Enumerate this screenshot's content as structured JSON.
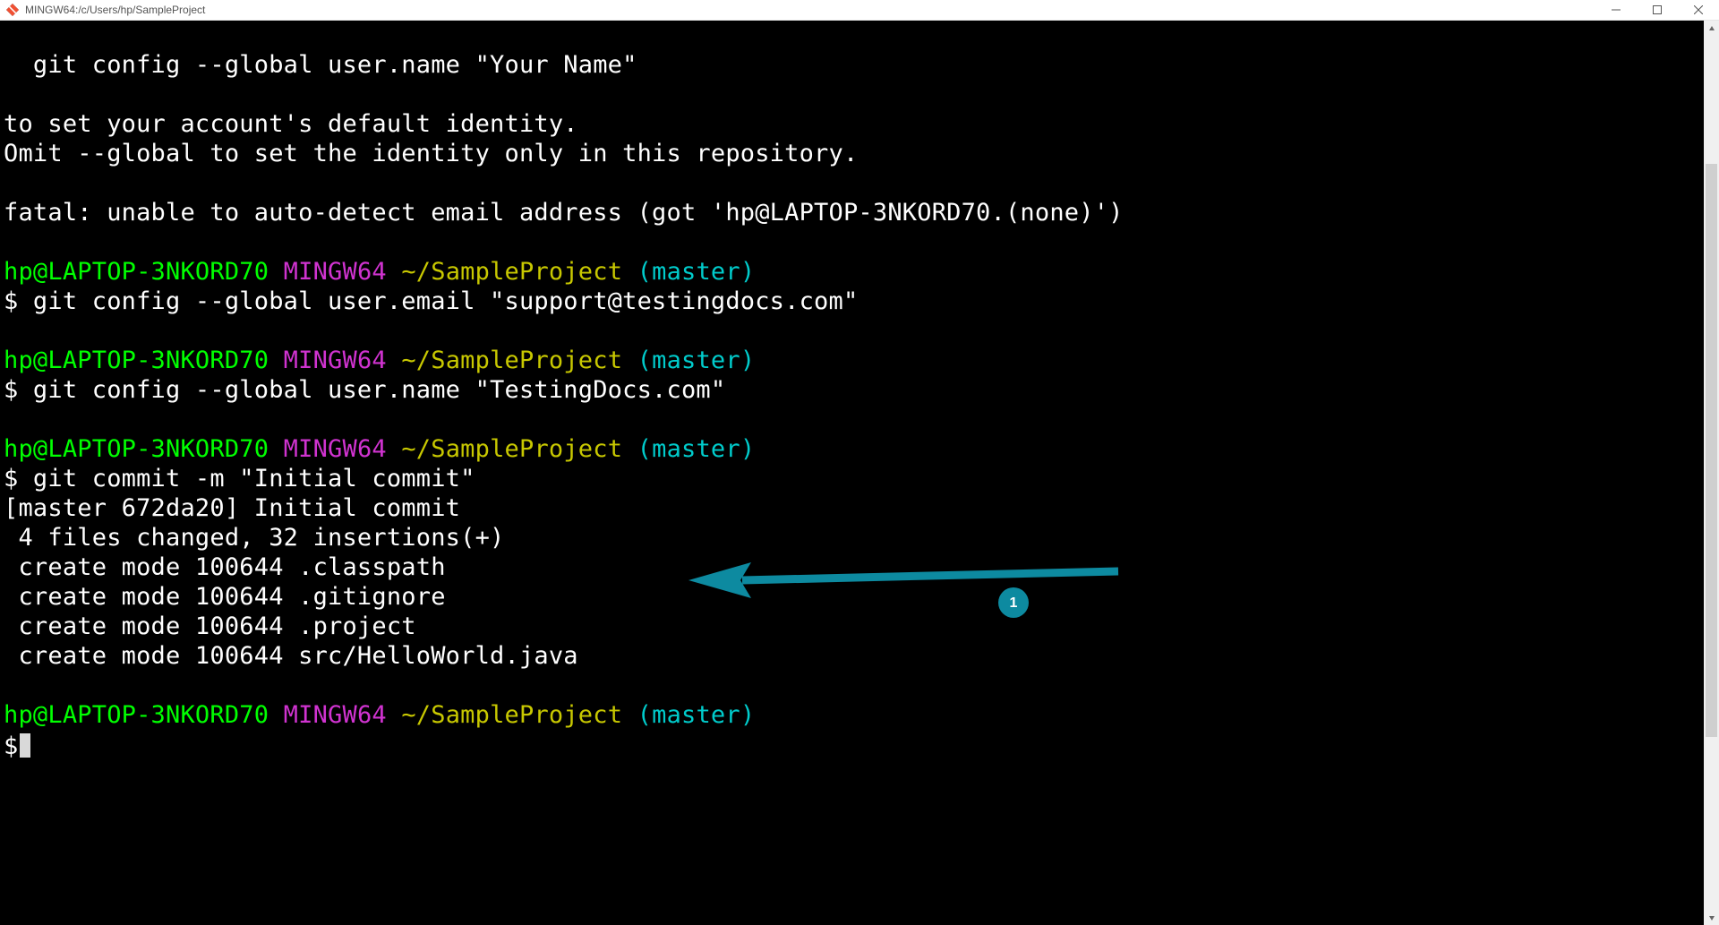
{
  "window": {
    "title": "MINGW64:/c/Users/hp/SampleProject"
  },
  "terminal": {
    "line_config_name_hint": "  git config --global user.name \"Your Name\"",
    "line_blank1": "",
    "line_set_default": "to set your account's default identity.",
    "line_omit_global": "Omit --global to set the identity only in this repository.",
    "line_blank2": "",
    "line_fatal": "fatal: unable to auto-detect email address (got 'hp@LAPTOP-3NKORD70.(none)')",
    "line_blank3": "",
    "prompt1": {
      "user": "hp@LAPTOP-3NKORD70",
      "env": "MINGW64",
      "path": "~/SampleProject",
      "branch": "(master)"
    },
    "cmd1": "$ git config --global user.email \"support@testingdocs.com\"",
    "line_blank4": "",
    "prompt2": {
      "user": "hp@LAPTOP-3NKORD70",
      "env": "MINGW64",
      "path": "~/SampleProject",
      "branch": "(master)"
    },
    "cmd2": "$ git config --global user.name \"TestingDocs.com\"",
    "line_blank5": "",
    "prompt3": {
      "user": "hp@LAPTOP-3NKORD70",
      "env": "MINGW64",
      "path": "~/SampleProject",
      "branch": "(master)"
    },
    "cmd3": "$ git commit -m \"Initial commit\"",
    "out_commit1": "[master 672da20] Initial commit",
    "out_commit2": " 4 files changed, 32 insertions(+)",
    "out_commit3": " create mode 100644 .classpath",
    "out_commit4": " create mode 100644 .gitignore",
    "out_commit5": " create mode 100644 .project",
    "out_commit6": " create mode 100644 src/HelloWorld.java",
    "line_blank6": "",
    "prompt4": {
      "user": "hp@LAPTOP-3NKORD70",
      "env": "MINGW64",
      "path": "~/SampleProject",
      "branch": "(master)"
    },
    "prompt_final_dollar": "$"
  },
  "annotation": {
    "badge_label": "1"
  }
}
